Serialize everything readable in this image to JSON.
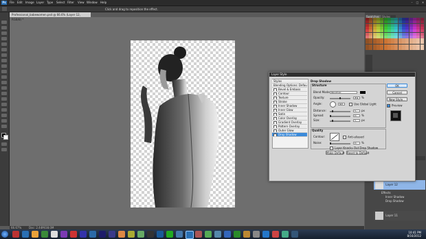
{
  "menubar": {
    "logo": "Ps",
    "items": [
      "File",
      "Edit",
      "Image",
      "Layer",
      "Type",
      "Select",
      "Filter",
      "View",
      "Window",
      "Help"
    ],
    "options_hint": "Click and drag to reposition the effect."
  },
  "document": {
    "tab_title": "Professional_babewomen.psd @ 66.6% (Layer 12, RGB/8) *"
  },
  "statusbar": {
    "zoom": "66.67%",
    "doc_size": "Doc: 2.44M/38.0M"
  },
  "dialog": {
    "title": "Layer Style",
    "styles_header": "Styles",
    "blending_options": "Blending Options: Default",
    "items": [
      {
        "label": "Bevel & Emboss",
        "checked": false,
        "selected": false
      },
      {
        "label": "Contour",
        "checked": false,
        "selected": false
      },
      {
        "label": "Texture",
        "checked": false,
        "selected": false
      },
      {
        "label": "Stroke",
        "checked": false,
        "selected": false
      },
      {
        "label": "Inner Shadow",
        "checked": false,
        "selected": false
      },
      {
        "label": "Inner Glow",
        "checked": false,
        "selected": false
      },
      {
        "label": "Satin",
        "checked": false,
        "selected": false
      },
      {
        "label": "Color Overlay",
        "checked": false,
        "selected": false
      },
      {
        "label": "Gradient Overlay",
        "checked": false,
        "selected": false
      },
      {
        "label": "Pattern Overlay",
        "checked": false,
        "selected": false
      },
      {
        "label": "Outer Glow",
        "checked": false,
        "selected": false
      },
      {
        "label": "Drop Shadow",
        "checked": true,
        "selected": true
      }
    ],
    "section_title": "Drop Shadow",
    "structure": "Structure",
    "blend_mode_label": "Blend Mode:",
    "blend_mode_value": "Normal",
    "opacity_label": "Opacity:",
    "opacity_value": "49",
    "angle_label": "Angle:",
    "angle_value": "90",
    "global_light": "Use Global Light",
    "distance_label": "Distance:",
    "distance_value": "5",
    "spread_label": "Spread:",
    "spread_value": "0",
    "size_label": "Size:",
    "size_value": "5",
    "quality": "Quality",
    "contour_label": "Contour:",
    "anti_aliased": "Anti-aliased",
    "noise_label": "Noise:",
    "noise_value": "0",
    "knockout": "Layer Knocks Out Drop Shadow",
    "make_default": "Make Default",
    "reset_default": "Reset to Default",
    "ok": "OK",
    "cancel": "Cancel",
    "new_style": "New Style...",
    "preview": "Preview",
    "unit_percent": "%",
    "unit_px": "px"
  },
  "panels": {
    "tab_swatches": "Swatches",
    "tab_styles": "Styles",
    "layer_name": "Layer 12",
    "effects": "Effects",
    "effect_1": "Inner Shadow",
    "effect_2": "Drop Shadow",
    "layer_2": "Layer 11"
  },
  "taskbar": {
    "time": "10:41 PM",
    "date": "8/16/2012"
  },
  "colors": {
    "accent": "#3b8ad9",
    "dialog_bg": "#d4d4d4",
    "workspace": "#6e6e6e"
  }
}
